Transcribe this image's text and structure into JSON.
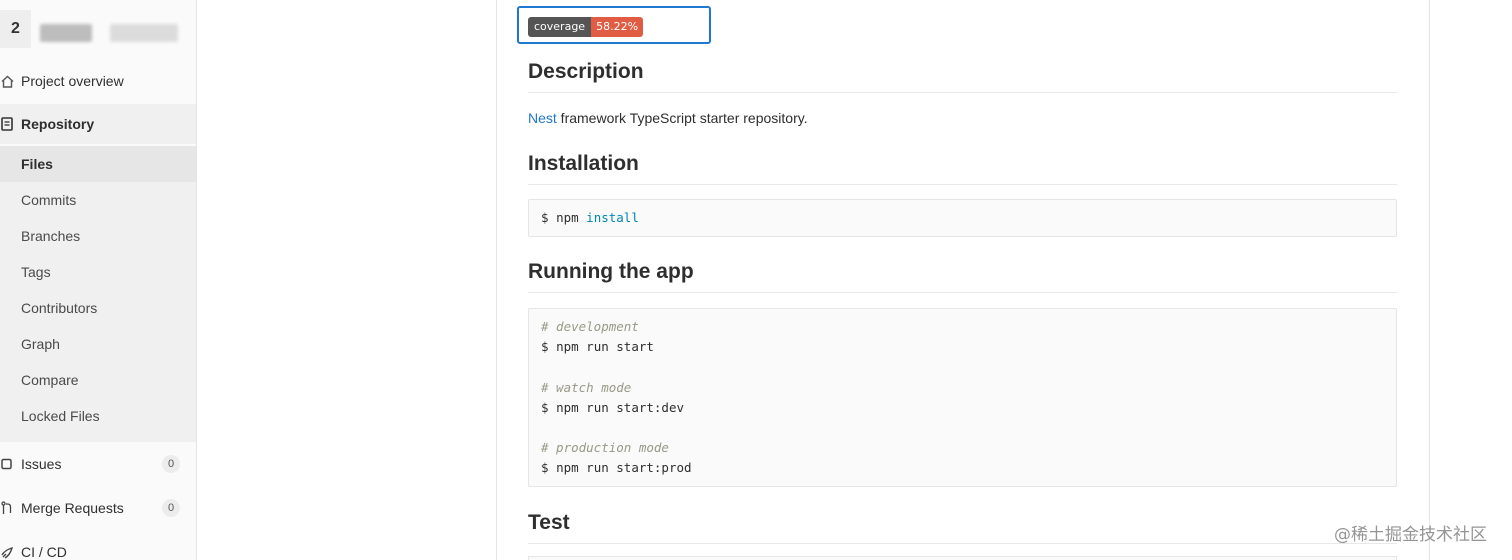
{
  "sidebar": {
    "project_avatar_letter": "2",
    "items": [
      {
        "label": "Project overview",
        "icon": "home-icon"
      },
      {
        "label": "Repository",
        "icon": "document-icon"
      },
      {
        "label": "Issues",
        "icon": "issues-icon",
        "count": "0"
      },
      {
        "label": "Merge Requests",
        "icon": "merge-request-icon",
        "count": "0"
      },
      {
        "label": "CI / CD",
        "icon": "rocket-icon"
      }
    ],
    "repository_sub": [
      "Files",
      "Commits",
      "Branches",
      "Tags",
      "Contributors",
      "Graph",
      "Compare",
      "Locked Files"
    ]
  },
  "readme": {
    "badge": {
      "key": "coverage",
      "value": "58.22%"
    },
    "description_heading": "Description",
    "description_link": "Nest",
    "description_rest": " framework TypeScript starter repository.",
    "installation_heading": "Installation",
    "install_code": {
      "prompt": "$",
      "cmd": "npm",
      "kw": "install"
    },
    "running_heading": "Running the app",
    "running_code": [
      {
        "comment": "# development",
        "prompt": "$",
        "cmd": "npm run start"
      },
      {
        "comment": "# watch mode",
        "prompt": "$",
        "cmd": "npm run start:dev"
      },
      {
        "comment": "# production mode",
        "prompt": "$",
        "cmd": "npm run start:prod"
      }
    ],
    "test_heading": "Test"
  },
  "watermark": "@稀土掘金技术社区",
  "colors": {
    "link": "#1f78d1",
    "badge_key": "#555555",
    "badge_value": "#e05d44",
    "focus_ring": "#1f78d1"
  }
}
